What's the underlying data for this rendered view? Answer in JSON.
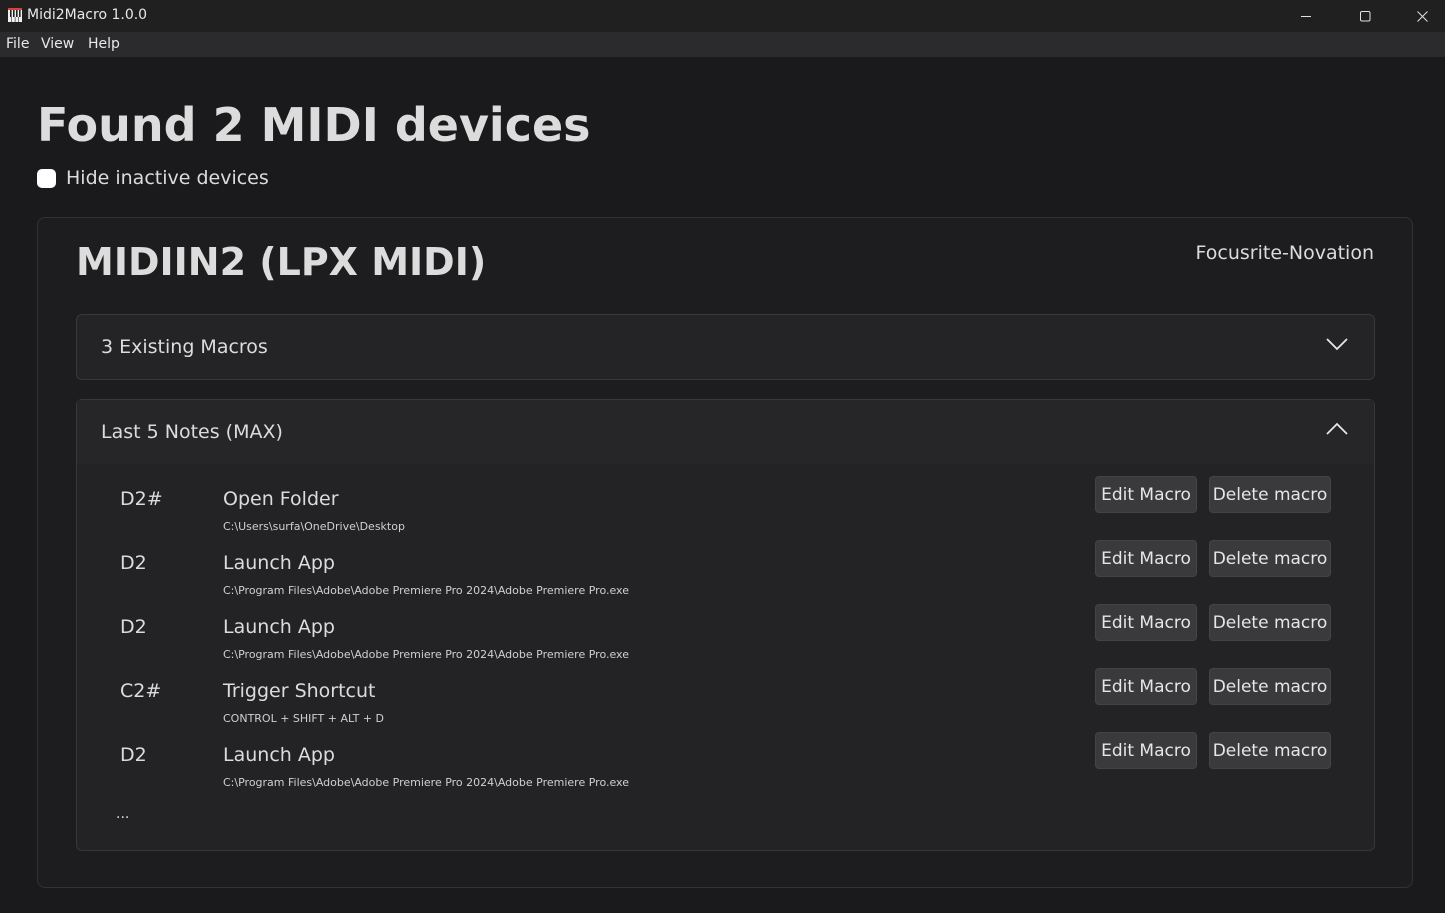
{
  "window": {
    "title": "Midi2Macro 1.0.0",
    "app_icon": "piano-keys-icon",
    "controls": {
      "minimize": "minimize-icon",
      "maximize": "maximize-icon",
      "close": "close-icon"
    }
  },
  "menu": {
    "items": [
      {
        "label": "File"
      },
      {
        "label": "View"
      },
      {
        "label": "Help"
      }
    ]
  },
  "main": {
    "title": "Found 2 MIDI devices",
    "hide_inactive": {
      "label": "Hide inactive devices",
      "checked": false
    }
  },
  "device": {
    "name": "MIDIIN2 (LPX MIDI)",
    "vendor": "Focusrite-Novation",
    "existing_macros": {
      "title": "3 Existing Macros",
      "expanded": false,
      "chevron": "chevron-down-icon"
    },
    "last_notes": {
      "title": "Last 5 Notes (MAX)",
      "expanded": true,
      "chevron": "chevron-up-icon",
      "rows": [
        {
          "note": "D2#",
          "action": "Open Folder",
          "detail": "C:\\Users\\surfa\\OneDrive\\Desktop",
          "edit_label": "Edit Macro",
          "delete_label": "Delete macro"
        },
        {
          "note": "D2",
          "action": "Launch App",
          "detail": "C:\\Program Files\\Adobe\\Adobe Premiere Pro 2024\\Adobe Premiere Pro.exe",
          "edit_label": "Edit Macro",
          "delete_label": "Delete macro"
        },
        {
          "note": "D2",
          "action": "Launch App",
          "detail": "C:\\Program Files\\Adobe\\Adobe Premiere Pro 2024\\Adobe Premiere Pro.exe",
          "edit_label": "Edit Macro",
          "delete_label": "Delete macro"
        },
        {
          "note": "C2#",
          "action": "Trigger Shortcut",
          "detail": "CONTROL + SHIFT + ALT + D",
          "edit_label": "Edit Macro",
          "delete_label": "Delete macro"
        },
        {
          "note": "D2",
          "action": "Launch App",
          "detail": "C:\\Program Files\\Adobe\\Adobe Premiere Pro 2024\\Adobe Premiere Pro.exe",
          "edit_label": "Edit Macro",
          "delete_label": "Delete macro"
        }
      ],
      "more": "..."
    }
  },
  "colors": {
    "background": "#1a1a1c",
    "card": "#1d1d1f",
    "accordion": "#242426",
    "button": "#3a3a3c",
    "text": "#dcdcdc",
    "app_icon_accent": "#d9413a"
  }
}
